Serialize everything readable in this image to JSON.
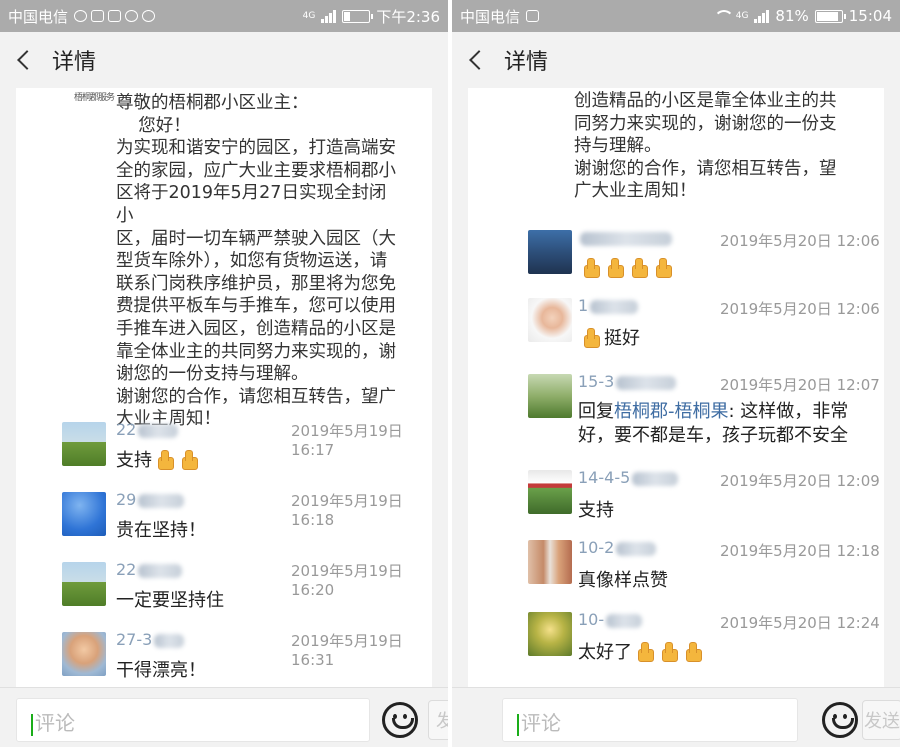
{
  "left": {
    "status": {
      "carrier": "中国电信",
      "network": "4G",
      "time": "下午2:36"
    },
    "header": {
      "title": "详情"
    },
    "post": {
      "lines": "尊敬的梧桐郡小区业主：\n    您好！\n为实现和谐安宁的园区，打造高端安\n全的家园，应广大业主要求梧桐郡小\n区将于2019年5月27日实现全封闭小\n区，届时一切车辆严禁驶入园区（大\n型货车除外），如您有货物运送，请\n联系门岗秩序维护员，那里将为您免\n费提供平板车与手推车，您可以使用\n手推车进入园区，创造精品的小区是\n靠全体业主的共同努力来实现的，谢\n谢您的一份支持与理解。\n谢谢您的合作，请您相互转告，望广\n大业主周知！"
    },
    "comments": [
      {
        "name": "22",
        "time": "2019年5月19日 16:17",
        "text": "支持",
        "thumbs": 2,
        "avatar": "field"
      },
      {
        "name": "29",
        "time": "2019年5月19日 16:18",
        "text": "贵在坚持！",
        "thumbs": 0,
        "avatar": "sky"
      },
      {
        "name": "22",
        "time": "2019年5月19日 16:20",
        "text": "一定要坚持住",
        "thumbs": 0,
        "avatar": "field"
      },
      {
        "name": "27-3",
        "time": "2019年5月19日 16:31",
        "text": "干得漂亮！",
        "thumbs": 0,
        "avatar": "kid"
      }
    ],
    "bottom": {
      "placeholder": "评论",
      "send_label": "发送"
    }
  },
  "right": {
    "status": {
      "carrier": "中国电信",
      "network": "4G",
      "battery": "81%",
      "time": "15:04"
    },
    "header": {
      "title": "详情"
    },
    "post": {
      "lines": "创造精品的小区是靠全体业主的共\n同努力来实现的，谢谢您的一份支\n持与理解。\n谢谢您的合作，请您相互转告，望\n广大业主周知！"
    },
    "comments": [
      {
        "name": "",
        "time": "2019年5月20日 12:06",
        "text": "",
        "thumbs": 4,
        "avatar": "city"
      },
      {
        "name": "1",
        "time": "2019年5月20日 12:06",
        "text": "挺好",
        "thumbs": 1,
        "avatar": "girl"
      },
      {
        "name": "15-3",
        "time": "2019年5月20日 12:07",
        "reply_prefix": "回复",
        "reply_to": "梧桐郡-梧桐果",
        "text": ": 这样做，非常\n好，要不都是车，孩子玩都不安全",
        "thumbs": 0,
        "avatar": "tree"
      },
      {
        "name": "14-4-5",
        "time": "2019年5月20日 12:09",
        "text": "支持",
        "thumbs": 0,
        "avatar": "shop"
      },
      {
        "name": "10-2",
        "time": "2019年5月20日 12:18",
        "text": "真像样点赞",
        "thumbs": 0,
        "avatar": "people"
      },
      {
        "name": "10-",
        "time": "2019年5月20日 12:24",
        "text": "太好了",
        "thumbs": 3,
        "avatar": "green"
      }
    ],
    "bottom": {
      "placeholder": "评论",
      "send_label": "发送"
    }
  }
}
